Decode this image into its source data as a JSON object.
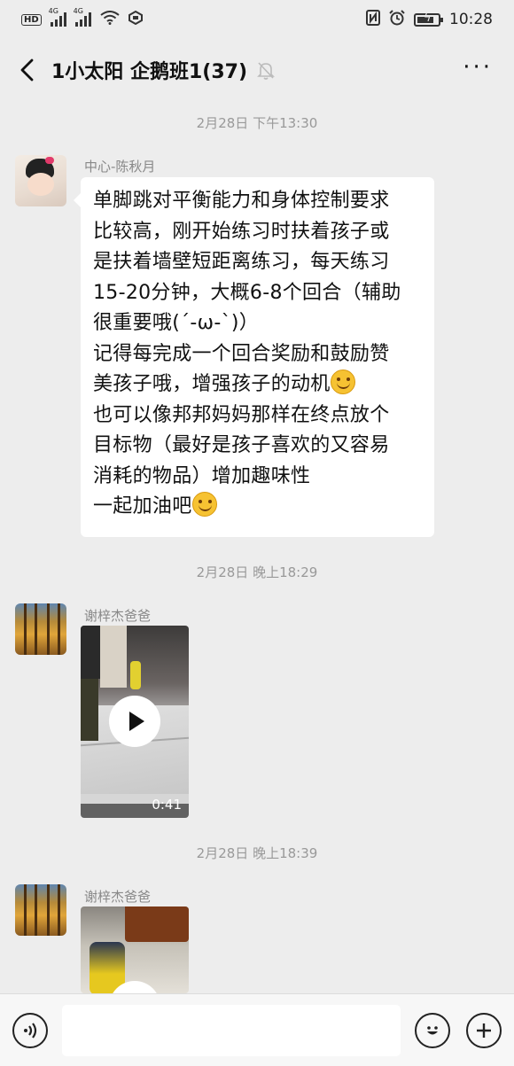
{
  "status_bar": {
    "left_badge": "HD",
    "signal1_label": "4G",
    "signal2_label": "4G",
    "time": "10:28",
    "icons": [
      "nfc-icon",
      "alarm-icon",
      "battery-icon"
    ]
  },
  "header": {
    "title": "1小太阳 企鹅班1(37)",
    "back_icon": "back-arrow-icon",
    "mute_icon": "mute-bell-icon",
    "more_icon": "more-icon"
  },
  "messages": [
    {
      "timestamp": "2月28日 下午13:30",
      "sender": "中心-陈秋月",
      "type": "text",
      "lines": [
        "单脚跳对平衡能力和身体控制要求",
        "比较高，刚开始练习时扶着孩子或",
        "是扶着墙壁短距离练习，每天练习",
        "15-20分钟，大概6-8个回合（辅助",
        "很重要哦(´-ω-`)）",
        "记得每完成一个回合奖励和鼓励赞",
        "美孩子哦，增强孩子的动机",
        "也可以像邦邦妈妈那样在终点放个",
        "目标物（最好是孩子喜欢的又容易",
        "消耗的物品）增加趣味性",
        "一起加油吧"
      ]
    },
    {
      "timestamp": "2月28日 晚上18:29",
      "sender": "谢梓杰爸爸",
      "type": "video",
      "duration": "0:41"
    },
    {
      "timestamp": "2月28日 晚上18:39",
      "sender": "谢梓杰爸爸",
      "type": "video"
    }
  ],
  "input_bar": {
    "voice_icon": "voice-icon",
    "emoji_icon": "emoji-icon",
    "add_icon": "plus-icon"
  }
}
